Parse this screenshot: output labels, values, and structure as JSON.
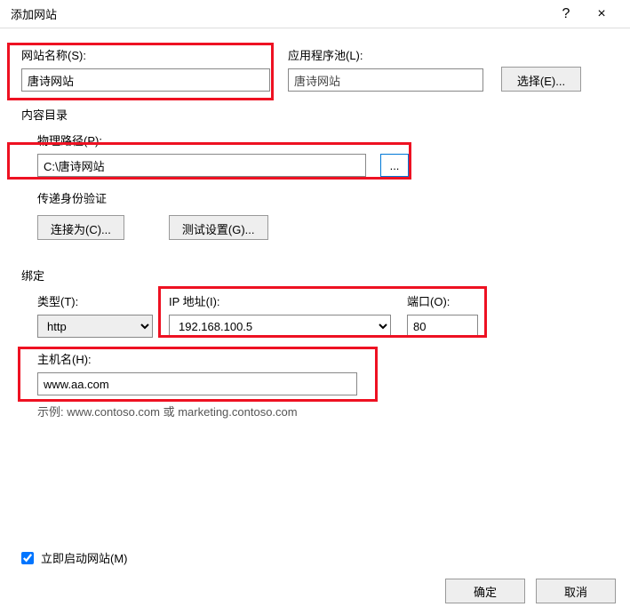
{
  "titlebar": {
    "title": "添加网站",
    "help": "?",
    "close": "×"
  },
  "siteName": {
    "label": "网站名称(S):",
    "value": "唐诗网站"
  },
  "appPool": {
    "label": "应用程序池(L):",
    "value": "唐诗网站",
    "selectBtn": "选择(E)..."
  },
  "contentDir": {
    "title": "内容目录",
    "physicalPathLabel": "物理路径(P):",
    "physicalPathValue": "C:\\唐诗网站",
    "browse": "..."
  },
  "auth": {
    "title": "传递身份验证",
    "connectAs": "连接为(C)...",
    "testSettings": "测试设置(G)..."
  },
  "binding": {
    "title": "绑定",
    "typeLabel": "类型(T):",
    "typeValue": "http",
    "ipLabel": "IP 地址(I):",
    "ipValue": "192.168.100.5",
    "portLabel": "端口(O):",
    "portValue": "80",
    "hostLabel": "主机名(H):",
    "hostValue": "www.aa.com",
    "example": "示例: www.contoso.com 或 marketing.contoso.com"
  },
  "startNow": {
    "label": "立即启动网站(M)"
  },
  "footer": {
    "ok": "确定",
    "cancel": "取消"
  }
}
